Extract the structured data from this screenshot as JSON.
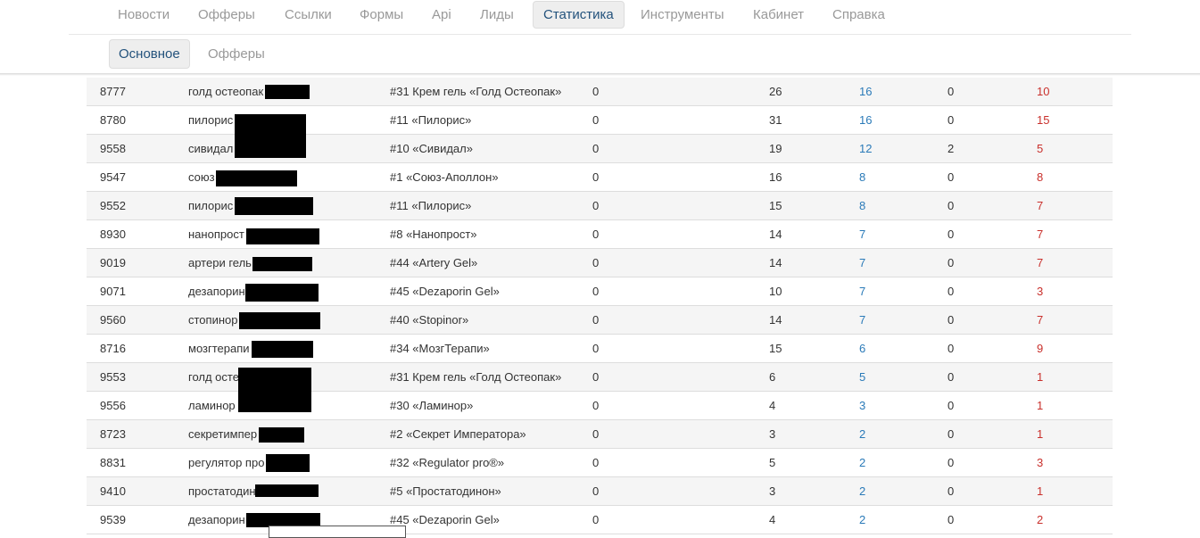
{
  "top_nav": {
    "items": [
      {
        "label": "Новости",
        "active": false
      },
      {
        "label": "Офферы",
        "active": false
      },
      {
        "label": "Ссылки",
        "active": false
      },
      {
        "label": "Формы",
        "active": false
      },
      {
        "label": "Api",
        "active": false
      },
      {
        "label": "Лиды",
        "active": false
      },
      {
        "label": "Статистика",
        "active": true
      },
      {
        "label": "Инструменты",
        "active": false
      },
      {
        "label": "Кабинет",
        "active": false
      },
      {
        "label": "Справка",
        "active": false
      }
    ]
  },
  "sub_nav": {
    "items": [
      {
        "label": "Основное",
        "active": true
      },
      {
        "label": "Офферы",
        "active": false
      }
    ]
  },
  "colors": {
    "link_blue": "#2a7ab8",
    "red": "#c9302c",
    "active_tab_text": "#23527c"
  },
  "table": {
    "rows": [
      {
        "id": "8777",
        "name": "голд остеопак",
        "offer": "#31 Крем гель «Голд Остеопак»",
        "v1": "0",
        "v2": "26",
        "v3": "16",
        "v4": "0",
        "v5": "10"
      },
      {
        "id": "8780",
        "name": "пилорис",
        "offer": "#11 «Пилорис»",
        "v1": "0",
        "v2": "31",
        "v3": "16",
        "v4": "0",
        "v5": "15"
      },
      {
        "id": "9558",
        "name": "сивидал",
        "offer": "#10 «Сивидал»",
        "v1": "0",
        "v2": "19",
        "v3": "12",
        "v4": "2",
        "v5": "5"
      },
      {
        "id": "9547",
        "name": "союз",
        "offer": "#1 «Союз-Аполлон»",
        "v1": "0",
        "v2": "16",
        "v3": "8",
        "v4": "0",
        "v5": "8"
      },
      {
        "id": "9552",
        "name": "пилорис",
        "offer": "#11 «Пилорис»",
        "v1": "0",
        "v2": "15",
        "v3": "8",
        "v4": "0",
        "v5": "7"
      },
      {
        "id": "8930",
        "name": "нанопрост",
        "offer": "#8 «Нанопрост»",
        "v1": "0",
        "v2": "14",
        "v3": "7",
        "v4": "0",
        "v5": "7"
      },
      {
        "id": "9019",
        "name": "артери гель",
        "offer": "#44 «Artery Gel»",
        "v1": "0",
        "v2": "14",
        "v3": "7",
        "v4": "0",
        "v5": "7"
      },
      {
        "id": "9071",
        "name": "дезапорин",
        "offer": "#45 «Dezaporin Gel»",
        "v1": "0",
        "v2": "10",
        "v3": "7",
        "v4": "0",
        "v5": "3"
      },
      {
        "id": "9560",
        "name": "стопинор",
        "offer": "#40 «Stopinor»",
        "v1": "0",
        "v2": "14",
        "v3": "7",
        "v4": "0",
        "v5": "7"
      },
      {
        "id": "8716",
        "name": "мозгтерапи",
        "offer": "#34 «МозгТерапи»",
        "v1": "0",
        "v2": "15",
        "v3": "6",
        "v4": "0",
        "v5": "9"
      },
      {
        "id": "9553",
        "name": "голд осте",
        "offer": "#31 Крем гель «Голд Остеопак»",
        "v1": "0",
        "v2": "6",
        "v3": "5",
        "v4": "0",
        "v5": "1"
      },
      {
        "id": "9556",
        "name": "ламинор",
        "offer": "#30 «Ламинор»",
        "v1": "0",
        "v2": "4",
        "v3": "3",
        "v4": "0",
        "v5": "1"
      },
      {
        "id": "8723",
        "name": "секретимпер",
        "offer": "#2 «Секрет Императора»",
        "v1": "0",
        "v2": "3",
        "v3": "2",
        "v4": "0",
        "v5": "1"
      },
      {
        "id": "8831",
        "name": "регулятор про",
        "offer": "#32 «Regulator pro®»",
        "v1": "0",
        "v2": "5",
        "v3": "2",
        "v4": "0",
        "v5": "3"
      },
      {
        "id": "9410",
        "name": "простатодин",
        "offer": "#5 «Простатодинон»",
        "v1": "0",
        "v2": "3",
        "v3": "2",
        "v4": "0",
        "v5": "1"
      },
      {
        "id": "9539",
        "name": "дезапорин",
        "offer": "#45 «Dezaporin Gel»",
        "v1": "0",
        "v2": "4",
        "v3": "2",
        "v4": "0",
        "v5": "2"
      }
    ]
  }
}
